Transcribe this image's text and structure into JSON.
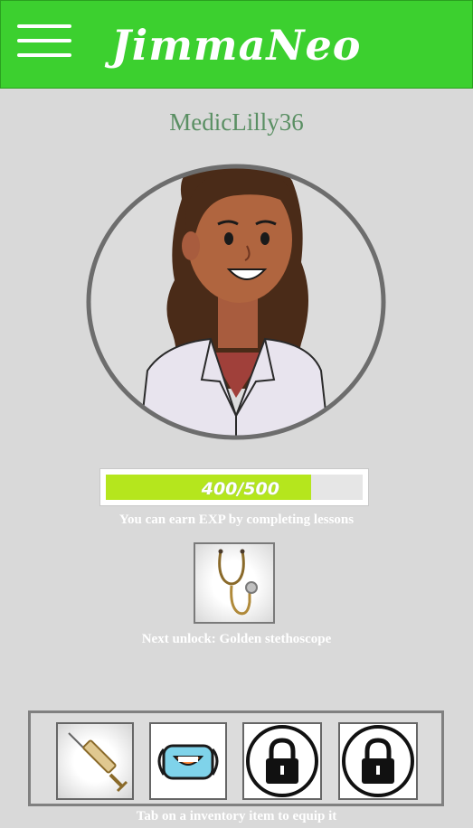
{
  "header": {
    "brand": "JimmaNeo",
    "menu_icon": "hamburger-menu-icon"
  },
  "profile": {
    "username": "MedicLilly36",
    "avatar_icon": "doctor-avatar-illustration"
  },
  "exp": {
    "current": 400,
    "max": 500,
    "label": "400/500",
    "hint": "You can earn EXP by completing lessons"
  },
  "next_unlock": {
    "icon": "golden-stethoscope-icon",
    "label": "Next unlock: Golden stethoscope"
  },
  "inventory": {
    "items": [
      {
        "name": "syringe",
        "icon": "syringe-icon",
        "locked": false
      },
      {
        "name": "face mask",
        "icon": "face-mask-icon",
        "locked": false
      },
      {
        "name": "locked",
        "icon": "padlock-icon",
        "locked": true
      },
      {
        "name": "locked",
        "icon": "padlock-icon",
        "locked": true
      }
    ],
    "hint": "Tab on a inventory item to equip it"
  },
  "colors": {
    "header": "#3cd02f",
    "exp_fill": "#b5e61d",
    "username": "#5a8f63",
    "background": "#d9d9d9"
  }
}
